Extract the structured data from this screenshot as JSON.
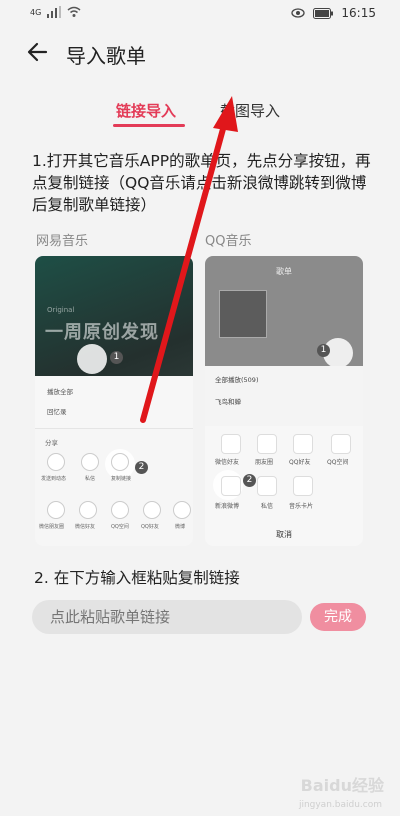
{
  "status": {
    "network": "4G",
    "time": "16:15"
  },
  "header": {
    "title": "导入歌单"
  },
  "tabs": [
    {
      "label": "链接导入",
      "active": true
    },
    {
      "label": "截图导入",
      "active": false
    }
  ],
  "step1": "1.打开其它音乐APP的歌单页，先点分享按钮，再点复制链接（QQ音乐请点击新浪微博跳转到微博后复制歌单链接）",
  "examples": {
    "left": {
      "label": "网易音乐",
      "banner_small": "Original",
      "banner_big": "一周原创发现",
      "sheet_title": "分享",
      "share_items": [
        "发送到动态",
        "私信",
        "复制链接"
      ],
      "share_items_2": [
        "微信朋友圈",
        "微信好友",
        "QQ空间",
        "QQ好友",
        "微博"
      ],
      "play_row": "播放全部",
      "song_row": "回忆录",
      "badge1": "1",
      "badge2": "2"
    },
    "right": {
      "label": "QQ音乐",
      "top_title": "歌单",
      "play_row": "全部播放(509)",
      "song_row": "飞鸟和蝉",
      "share_items": [
        "微信好友",
        "朋友圈",
        "QQ好友",
        "QQ空间"
      ],
      "share_items_2": [
        "新浪微博",
        "私信",
        "音乐卡片"
      ],
      "cancel": "取消",
      "badge1": "1",
      "badge2": "2"
    }
  },
  "step2": "2. 在下方输入框粘贴复制链接",
  "input": {
    "placeholder": "点此粘贴歌单链接"
  },
  "done_label": "完成",
  "watermark": {
    "main": "Baidu经验",
    "sub": "jingyan.baidu.com"
  },
  "colors": {
    "accent": "#e33b57",
    "done_button": "#f08ea0",
    "arrow": "#e0171b"
  }
}
